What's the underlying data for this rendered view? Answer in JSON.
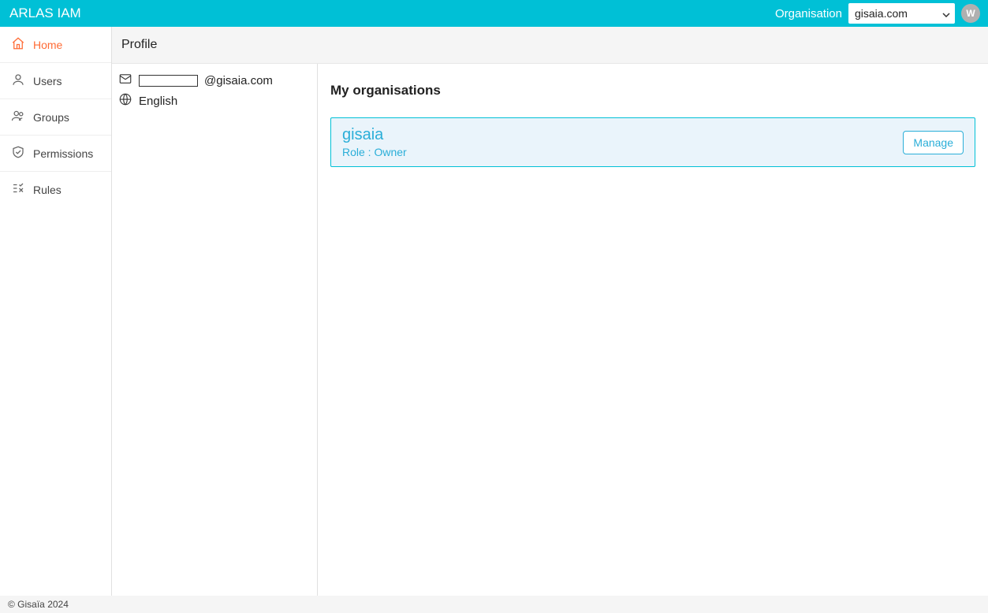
{
  "header": {
    "title": "ARLAS IAM",
    "org_label": "Organisation",
    "org_selected": "gisaia.com",
    "avatar_letter": "W"
  },
  "sidebar": {
    "items": [
      {
        "label": "Home"
      },
      {
        "label": "Users"
      },
      {
        "label": "Groups"
      },
      {
        "label": "Permissions"
      },
      {
        "label": "Rules"
      }
    ]
  },
  "page": {
    "title": "Profile"
  },
  "profile": {
    "email_suffix": "@gisaia.com",
    "language": "English"
  },
  "orgs": {
    "section_title": "My organisations",
    "items": [
      {
        "name": "gisaia",
        "role_line": "Role : Owner",
        "manage_label": "Manage"
      }
    ]
  },
  "footer": {
    "copyright": "© Gisaïa 2024"
  }
}
